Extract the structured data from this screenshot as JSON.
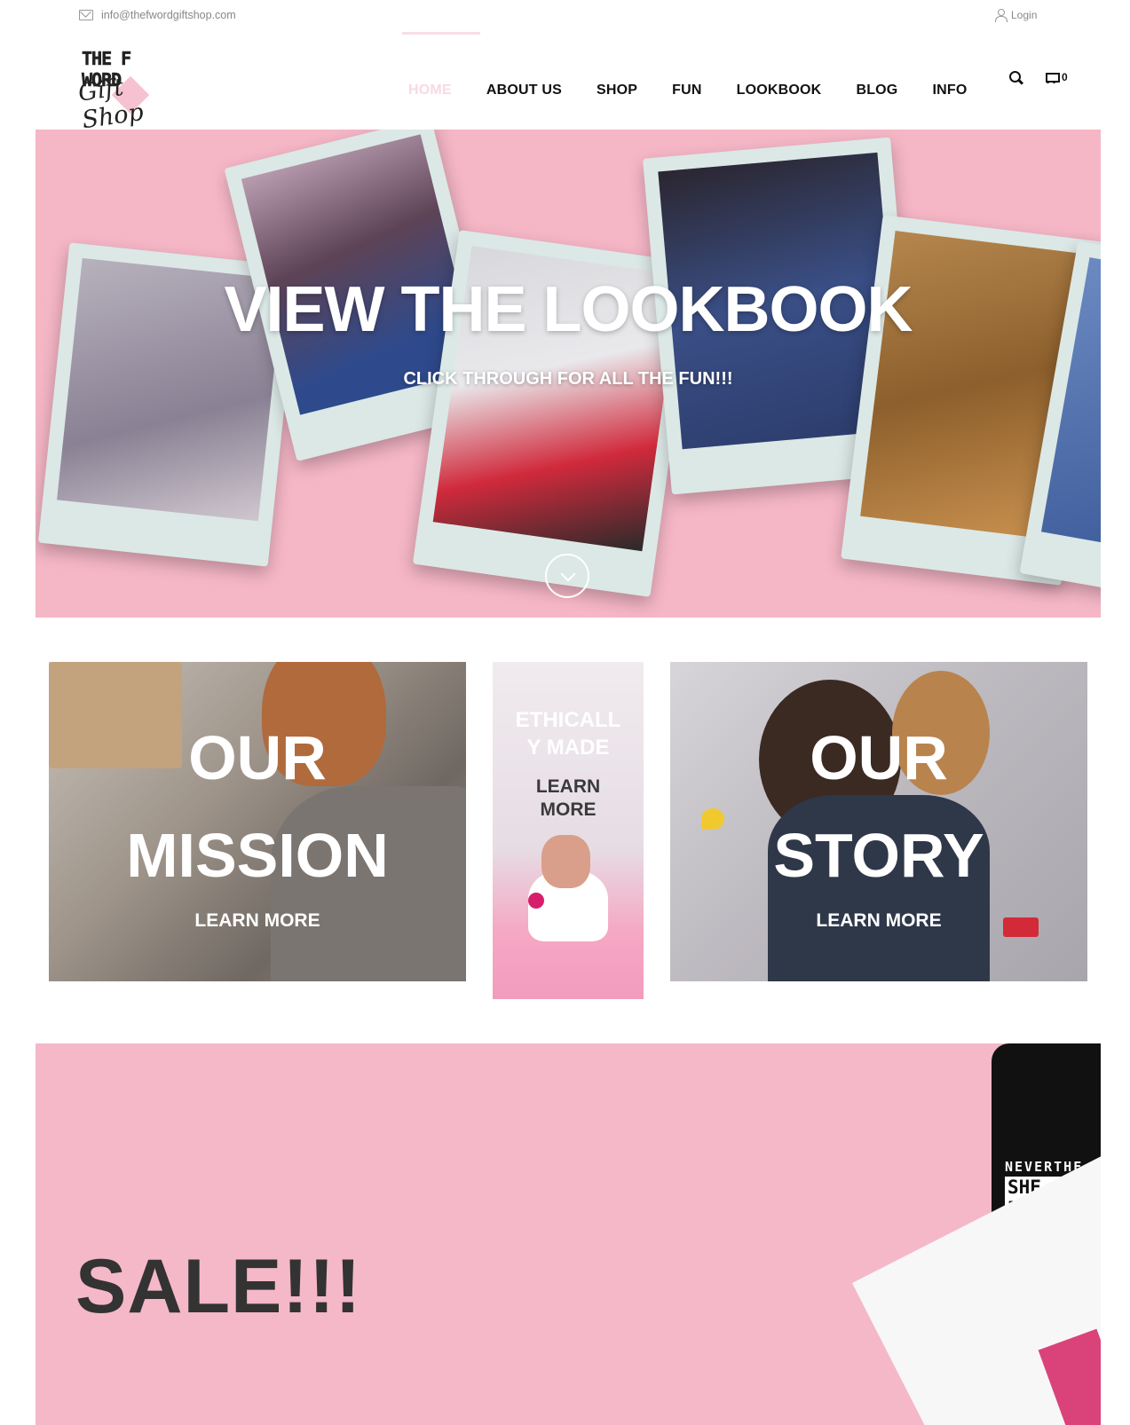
{
  "topbar": {
    "email": "info@thefwordgiftshop.com",
    "login_label": "Login"
  },
  "logo": {
    "line1": "THE F WORD",
    "line2": "Gift Shop"
  },
  "nav": {
    "items": [
      "HOME",
      "ABOUT US",
      "SHOP",
      "FUN",
      "LOOKBOOK",
      "BLOG",
      "INFO"
    ],
    "active_index": 0,
    "cart_count": "0"
  },
  "hero": {
    "title": "VIEW THE LOOKBOOK",
    "subtitle": "CLICK THROUGH FOR ALL THE FUN!!!"
  },
  "tiles": {
    "mission": {
      "line1": "OUR",
      "line2": "MISSION",
      "cta": "LEARN MORE"
    },
    "ethical": {
      "title_line1": "ETHICALL",
      "title_line2": "Y MADE",
      "cta_line1": "LEARN",
      "cta_line2": "MORE"
    },
    "story": {
      "line1": "OUR",
      "line2": "STORY",
      "cta": "LEARN MORE"
    }
  },
  "sale": {
    "title": "SALE!!!",
    "shirt_line1": "NEVERTHE",
    "shirt_line2": "SHE PERSI"
  },
  "colors": {
    "hero_pink": "#f5b6c6",
    "sale_pink": "#f5b8c9",
    "active_nav": "#f8d9e2",
    "text_dark": "#111111"
  }
}
